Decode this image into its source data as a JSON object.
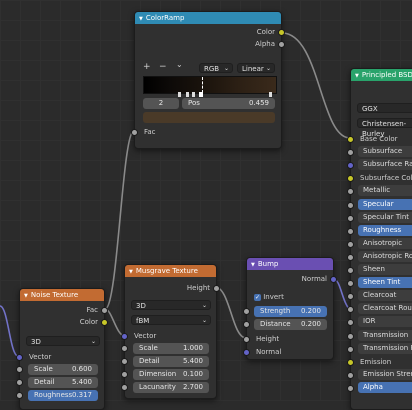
{
  "colors": {
    "background": "#2b2b2b",
    "node_body": "#303030",
    "header_converter": "#2f8bb4",
    "header_texture": "#c26b32",
    "header_vector": "#6a4fb2",
    "header_shader": "#29a36b",
    "socket_color": "#c7c729",
    "socket_float": "#a1a1a1",
    "socket_vector": "#6363c7",
    "highlight": "#4772b3",
    "colorband_bar": "#4a3a28"
  },
  "colorramp": {
    "title": "ColorRamp",
    "out_color": "Color",
    "out_alpha": "Alpha",
    "add": "+",
    "remove": "−",
    "menu": "⌄",
    "color_mode": "RGB",
    "interpolation": "Linear",
    "stop_index": "2",
    "pos_label": "Pos",
    "pos_value": "0.459",
    "in_fac": "Fac"
  },
  "noise": {
    "title": "Noise Texture",
    "out_fac": "Fac",
    "out_color": "Color",
    "dimensions": "3D",
    "in_vector": "Vector",
    "fields": [
      {
        "k": "Scale",
        "v": "0.600"
      },
      {
        "k": "Detail",
        "v": "5.400"
      },
      {
        "k": "Roughness",
        "v": "0.317"
      }
    ]
  },
  "musgrave": {
    "title": "Musgrave Texture",
    "out_height": "Height",
    "dimensions": "3D",
    "type": "fBM",
    "in_vector": "Vector",
    "fields": [
      {
        "k": "Scale",
        "v": "1.000"
      },
      {
        "k": "Detail",
        "v": "5.400"
      },
      {
        "k": "Dimension",
        "v": "0.100"
      },
      {
        "k": "Lacunarity",
        "v": "2.700"
      }
    ]
  },
  "bump": {
    "title": "Bump",
    "out_normal": "Normal",
    "invert": "Invert",
    "invert_checked": true,
    "fields": [
      {
        "k": "Strength",
        "v": "0.200"
      },
      {
        "k": "Distance",
        "v": "0.200"
      }
    ],
    "in_height": "Height",
    "in_normal": "Normal"
  },
  "principled": {
    "title": "Principled BSDF",
    "distribution": "GGX",
    "subsurface_method": "Christensen-Burley",
    "inputs": [
      {
        "label": "Base Color",
        "sock": "yel",
        "style": "plain"
      },
      {
        "label": "Subsurface",
        "sock": "gry",
        "style": "field"
      },
      {
        "label": "Subsurface Radius",
        "sock": "vio",
        "style": "field"
      },
      {
        "label": "Subsurface Color",
        "sock": "yel",
        "style": "plain"
      },
      {
        "label": "Metallic",
        "sock": "gry",
        "style": "field"
      },
      {
        "label": "Specular",
        "sock": "gry",
        "style": "active"
      },
      {
        "label": "Specular Tint",
        "sock": "gry",
        "style": "field"
      },
      {
        "label": "Roughness",
        "sock": "gry",
        "style": "active"
      },
      {
        "label": "Anisotropic",
        "sock": "gry",
        "style": "field"
      },
      {
        "label": "Anisotropic Rotation",
        "sock": "gry",
        "style": "field"
      },
      {
        "label": "Sheen",
        "sock": "gry",
        "style": "field"
      },
      {
        "label": "Sheen Tint",
        "sock": "gry",
        "style": "active"
      },
      {
        "label": "Clearcoat",
        "sock": "gry",
        "style": "field"
      },
      {
        "label": "Clearcoat Roughness",
        "sock": "gry",
        "style": "field"
      },
      {
        "label": "IOR",
        "sock": "gry",
        "style": "field"
      },
      {
        "label": "Transmission",
        "sock": "gry",
        "style": "field"
      },
      {
        "label": "Transmission Roughness",
        "sock": "gry",
        "style": "field"
      },
      {
        "label": "Emission",
        "sock": "yel",
        "style": "plain"
      },
      {
        "label": "Emission Strength",
        "sock": "gry",
        "style": "field"
      },
      {
        "label": "Alpha",
        "sock": "gry",
        "style": "active"
      }
    ]
  }
}
